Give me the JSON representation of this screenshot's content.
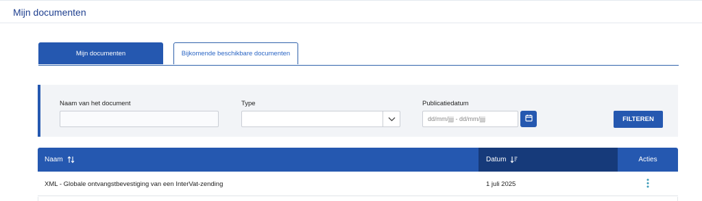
{
  "header": {
    "title": "Mijn documenten"
  },
  "tabs": [
    {
      "label": "Mijn documenten",
      "active": true
    },
    {
      "label": "Bijkomende beschikbare documenten",
      "active": false
    }
  ],
  "filters": {
    "name_label": "Naam van het document",
    "name_value": "",
    "type_label": "Type",
    "type_value": "",
    "date_label": "Publicatiedatum",
    "date_placeholder": "dd/mm/jjjj - dd/mm/jjjj",
    "filter_button": "FILTEREN"
  },
  "table": {
    "columns": [
      "Naam",
      "Datum",
      "Acties"
    ],
    "rows": [
      {
        "name": "XML - Globale ontvangstbevestiging van een InterVat-zending",
        "date": "1 juli 2025"
      }
    ]
  },
  "colors": {
    "primary": "#2558b0",
    "header_dark": "#163a7a",
    "accent_teal": "#3a9ab8"
  },
  "icons": {
    "sort": "sort-arrows-icon",
    "sort_desc": "sort-descending-icon",
    "calendar": "calendar-icon",
    "chevron": "chevron-down-icon",
    "more": "more-vertical-icon"
  }
}
